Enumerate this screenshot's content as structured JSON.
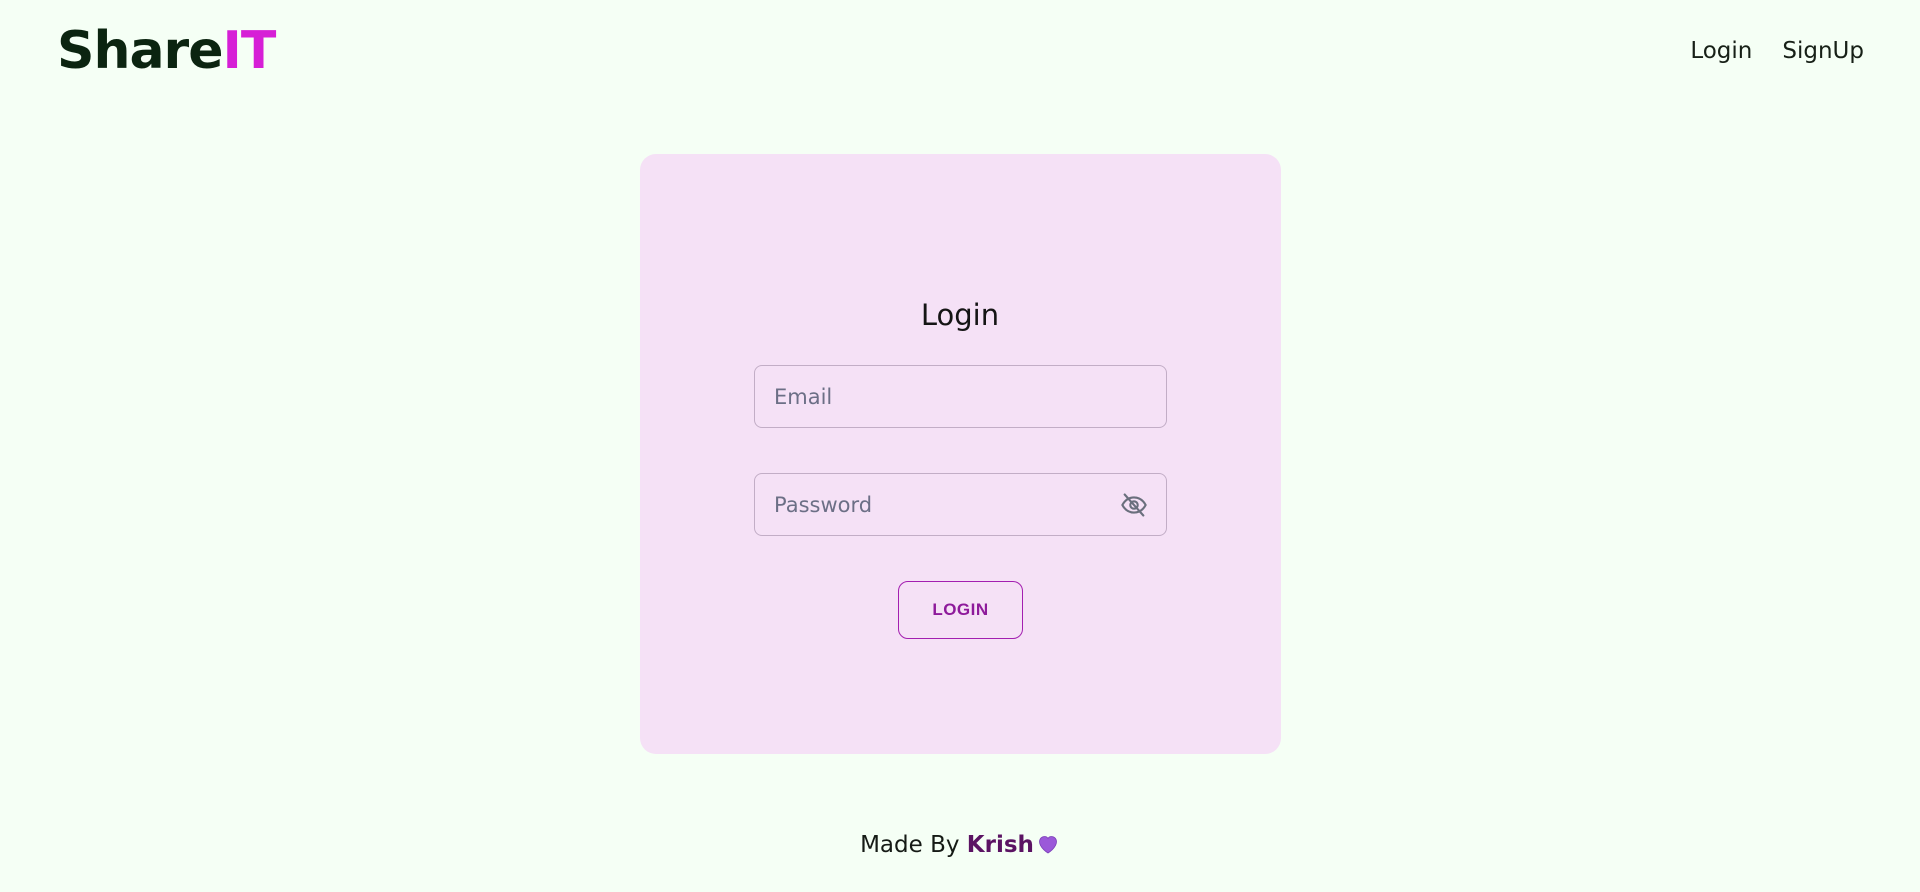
{
  "navbar": {
    "logo": {
      "part1": "Share",
      "part2": "IT"
    },
    "links": [
      {
        "label": "Login"
      },
      {
        "label": "SignUp"
      }
    ]
  },
  "login_card": {
    "title": "Login",
    "email": {
      "placeholder": "Email",
      "value": ""
    },
    "password": {
      "placeholder": "Password",
      "value": "",
      "toggle_icon": "eye-off-icon"
    },
    "submit_label": "LOGIN"
  },
  "footer": {
    "prefix": "Made By",
    "author": "Krish",
    "icon": "purple-heart-icon"
  },
  "colors": {
    "background": "#f5fff5",
    "card": "#f5e1f6",
    "brand_accent": "#d61fd6",
    "button": "#8e1a9b",
    "author": "#5b1363"
  }
}
